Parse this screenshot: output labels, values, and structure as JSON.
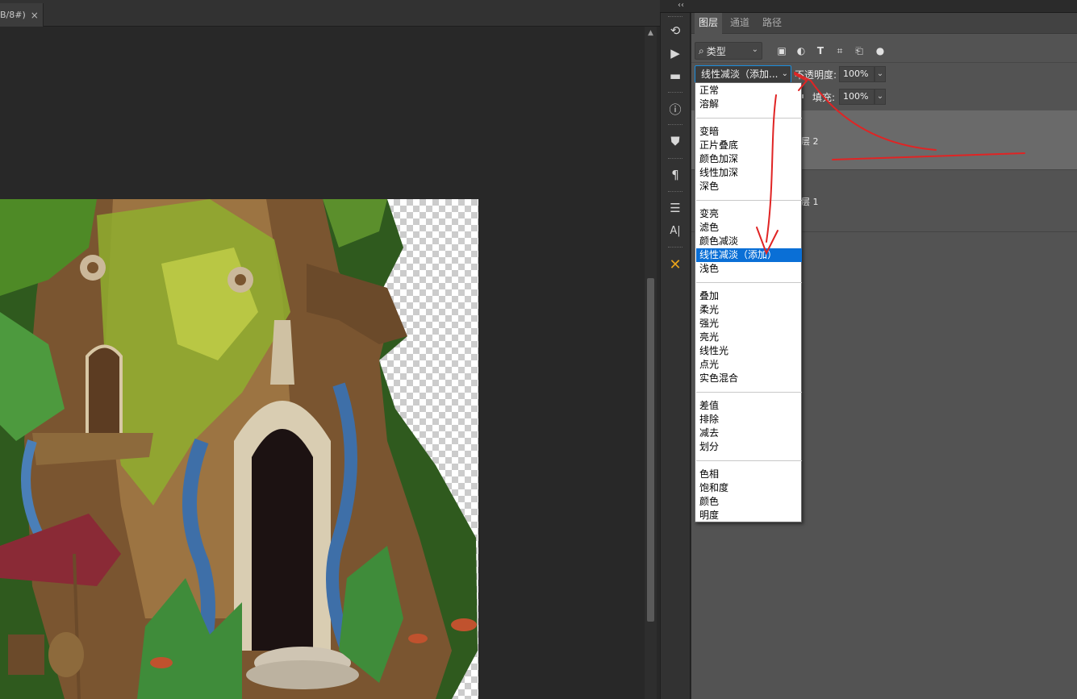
{
  "document": {
    "tab_label": "B/8#)",
    "close_glyph": "×"
  },
  "toolstrip": {
    "collapse_glyph": "‹‹",
    "tools": [
      {
        "name": "history-icon",
        "glyph": "⟲"
      },
      {
        "name": "actions-play-icon",
        "glyph": "▶"
      },
      {
        "name": "comments-icon",
        "glyph": "▬"
      },
      {
        "name": "info-icon",
        "glyph": "ⓘ"
      },
      {
        "name": "clone-source-icon",
        "glyph": "⛊"
      },
      {
        "name": "paragraph-icon",
        "glyph": "¶"
      },
      {
        "name": "adjustments-icon",
        "glyph": "☰"
      },
      {
        "name": "character-icon",
        "glyph": "A|"
      },
      {
        "name": "tools-preset-icon",
        "glyph": "✕"
      }
    ]
  },
  "panel": {
    "tabs": [
      "图层",
      "通道",
      "路径"
    ],
    "active_tab": "图层",
    "filter": {
      "label": "类型",
      "search_glyph": "⌕",
      "chevron": "⌄"
    },
    "filter_icons": [
      {
        "name": "pixel-layer-filter-icon",
        "glyph": "▣"
      },
      {
        "name": "adjustment-layer-filter-icon",
        "glyph": "◐"
      },
      {
        "name": "type-layer-filter-icon",
        "glyph": "T"
      },
      {
        "name": "shape-layer-filter-icon",
        "glyph": "⌗"
      },
      {
        "name": "smart-object-filter-icon",
        "glyph": "⎗"
      },
      {
        "name": "filter-toggle-icon",
        "glyph": "●"
      }
    ],
    "blend_mode": {
      "value": "线性减淡（添加...",
      "chevron": "⌄"
    },
    "opacity": {
      "label": "不透明度:",
      "value": "100%",
      "chevron": "⌄"
    },
    "fill": {
      "label": "填充:",
      "value": "100%",
      "chevron": "⌄"
    },
    "lock_glyph": "🔒",
    "layers": [
      {
        "name_partial": "层 2",
        "selected": true
      },
      {
        "name_partial": "层 1",
        "selected": false
      }
    ]
  },
  "blend_dropdown": {
    "groups": [
      [
        "正常",
        "溶解"
      ],
      [
        "变暗",
        "正片叠底",
        "颜色加深",
        "线性加深",
        "深色"
      ],
      [
        "变亮",
        "滤色",
        "颜色减淡",
        "线性减淡（添加）",
        "浅色"
      ],
      [
        "叠加",
        "柔光",
        "强光",
        "亮光",
        "线性光",
        "点光",
        "实色混合"
      ],
      [
        "差值",
        "排除",
        "减去",
        "划分"
      ],
      [
        "色相",
        "饱和度",
        "颜色",
        "明度"
      ]
    ],
    "selected": "线性减淡（添加）"
  },
  "colors": {
    "selection_blue": "#0a6fd6",
    "annotation_red": "#e02424",
    "panel_bg": "#535353"
  }
}
